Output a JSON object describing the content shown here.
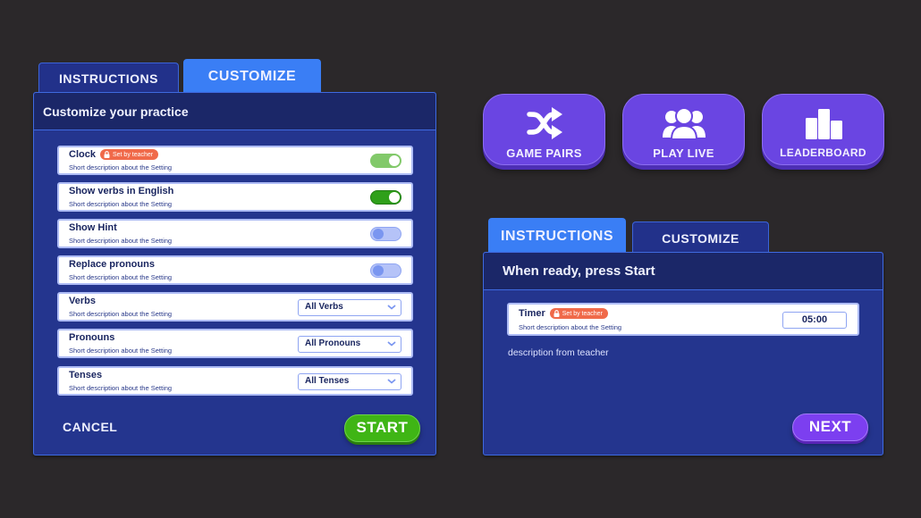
{
  "left_card": {
    "tabs": [
      {
        "label": "INSTRUCTIONS",
        "active": false
      },
      {
        "label": "CUSTOMIZE",
        "active": true
      }
    ],
    "header_title": "Customize your practice",
    "settings": [
      {
        "title": "Clock",
        "badge": "Set by teacher",
        "description": "Short description about the Setting",
        "control": "toggle",
        "state": "on-locked"
      },
      {
        "title": "Show verbs in English",
        "description": "Short description about the Setting",
        "control": "toggle",
        "state": "on"
      },
      {
        "title": "Show Hint",
        "description": "Short description about the Setting",
        "control": "toggle",
        "state": "off"
      },
      {
        "title": "Replace pronouns",
        "description": "Short description about the Setting",
        "control": "toggle",
        "state": "off"
      },
      {
        "title": "Verbs",
        "description": "Short description about the Setting",
        "control": "select",
        "value": "All Verbs"
      },
      {
        "title": "Pronouns",
        "description": "Short description about the Setting",
        "control": "select",
        "value": "All Pronouns"
      },
      {
        "title": "Tenses",
        "description": "Short description about the Setting",
        "control": "select",
        "value": "All Tenses"
      }
    ],
    "cancel_label": "CANCEL",
    "start_label": "START"
  },
  "game_modes": [
    {
      "label": "GAME PAIRS",
      "icon": "shuffle-icon"
    },
    {
      "label": "PLAY LIVE",
      "icon": "group-icon"
    },
    {
      "label": "LEADERBOARD",
      "icon": "bar-chart-icon"
    }
  ],
  "right_card": {
    "tabs": [
      {
        "label": "INSTRUCTIONS",
        "active": true
      },
      {
        "label": "CUSTOMIZE",
        "active": false
      }
    ],
    "header_title": "When ready, press Start",
    "timer": {
      "title": "Timer",
      "badge": "Set by teacher",
      "description": "Short description about the Setting",
      "value": "05:00"
    },
    "teacher_description": "description from teacher",
    "next_label": "NEXT"
  },
  "colors": {
    "background": "#2b282a",
    "panel": "#24358e",
    "panel_header": "#1b2768",
    "tab_active": "#3a7ef5",
    "start_green": "#3fb515",
    "next_purple": "#7c3ff0",
    "game_button": "#6a45e2",
    "badge_orange": "#f06a4a"
  }
}
